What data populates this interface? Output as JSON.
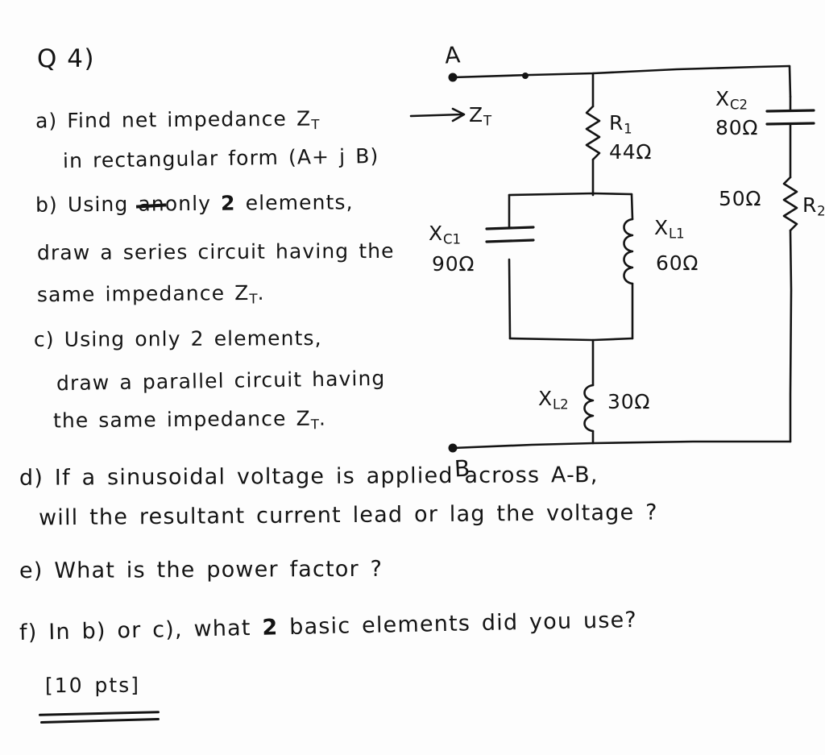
{
  "question": {
    "heading": "Q 4)",
    "parts": [
      {
        "id": "part-a",
        "label": "a)",
        "lines": [
          "Find net impedance Zₜ",
          "in rectangular form (A + j B)"
        ]
      },
      {
        "id": "part-b",
        "label": "b)",
        "struck_word": "an",
        "lines": [
          "Using  only  2 elements,",
          "draw a series circuit having the",
          "same  impedance  Zₜ ."
        ]
      },
      {
        "id": "part-c",
        "label": "c)",
        "lines": [
          "Using  only  2 elements,",
          "draw a parallel circuit having",
          "the same impedance Zₜ ."
        ]
      },
      {
        "id": "part-d",
        "label": "d)",
        "lines": [
          "If a sinusoidal voltage is applied across A-B,",
          "will the resultant current lead or lag the voltage ?"
        ]
      },
      {
        "id": "part-e",
        "label": "e)",
        "lines": [
          "What is the power factor ?"
        ]
      },
      {
        "id": "part-f",
        "label": "f)",
        "lines": [
          "In  b) or c),  what  2  basic elements did you use?"
        ]
      }
    ],
    "points": "[10 pts]"
  },
  "text_fragments": {
    "a_line1_pre": "Find net impedance",
    "a_line1_sym": "Z",
    "a_line1_sub": "T",
    "a_line2": "in rectangular form (A+ j B)",
    "b_line1_pre": "Using",
    "b_line1_struck": "an",
    "b_line1_post_a": "only",
    "b_line1_num": "2",
    "b_line1_post_b": "elements,",
    "b_line2": "draw  a  series  circuit  having  the",
    "b_line3_pre": "same   impedance",
    "b_line3_sym": "Z",
    "b_line3_sub": "T",
    "b_line3_end": ".",
    "c_line1": "Using   only   2  elements,",
    "c_line2": "draw  a  parallel  circuit  having",
    "c_line3_pre": "the  same  impedance",
    "c_line3_sym": "Z",
    "c_line3_sub": "T",
    "c_line3_end": ".",
    "d_line1": "If  a  sinusoidal  voltage  is  applied   across   A-B,",
    "d_line2": "will  the  resultant  current  lead  or  lag  the  voltage ?",
    "e_line1": "What  is  the  power  factor ?",
    "f_line1_pre": "In   b) or c),   what",
    "f_line1_num": "2",
    "f_line1_post": "basic elements did you use?",
    "points": "[10 pts]"
  },
  "circuit": {
    "title": "AC impedance network between terminals A and B",
    "terminals": [
      {
        "name": "node-a",
        "label": "A"
      },
      {
        "name": "node-b",
        "label": "B"
      }
    ],
    "source_arrow": {
      "label_symbol": "Z",
      "label_sub": "T",
      "direction": "right"
    },
    "components": [
      {
        "id": "r1",
        "type": "resistor",
        "symbol": "R",
        "subscript": "1",
        "value": "44Ω",
        "branch": "middle-top"
      },
      {
        "id": "xc1",
        "type": "capacitor",
        "symbol": "X",
        "subscript": "C1",
        "value": "90Ω",
        "branch": "parallel-left"
      },
      {
        "id": "xl1",
        "type": "inductor",
        "symbol": "X",
        "subscript": "L1",
        "value": "60Ω",
        "branch": "parallel-right"
      },
      {
        "id": "xl2",
        "type": "inductor",
        "symbol": "X",
        "subscript": "L2",
        "value": "30Ω",
        "branch": "middle-bottom"
      },
      {
        "id": "xc2",
        "type": "capacitor",
        "symbol": "X",
        "subscript": "C2",
        "value": "80Ω",
        "branch": "right-top"
      },
      {
        "id": "r2",
        "type": "resistor",
        "symbol": "R",
        "subscript": "2",
        "value": "50Ω",
        "branch": "right-bottom"
      }
    ]
  },
  "colors": {
    "ink": "#141414",
    "paper": "#fdfdfd"
  }
}
